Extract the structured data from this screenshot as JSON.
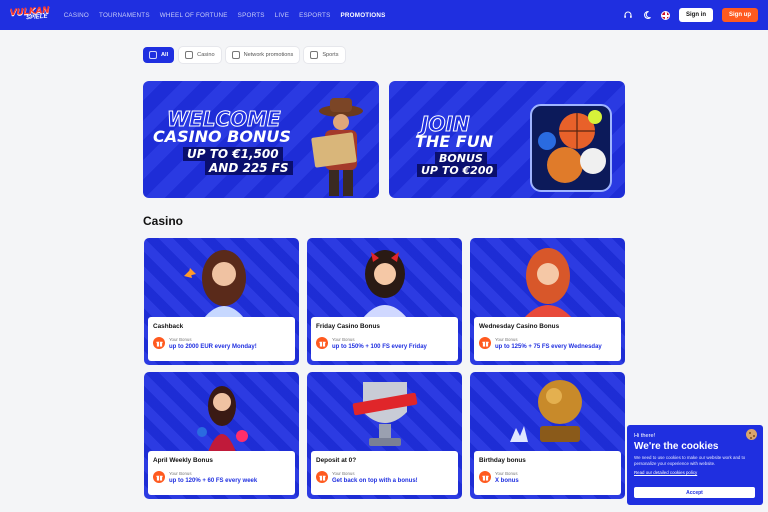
{
  "header": {
    "logo_top": "VULKAN",
    "logo_bottom": "SPIELE",
    "nav": [
      "CASINO",
      "TOURNAMENTS",
      "WHEEL OF FORTUNE",
      "SPORTS",
      "LIVE",
      "ESPORTS",
      "PROMOTIONS"
    ],
    "active_nav": "PROMOTIONS",
    "sign_in": "Sign in",
    "sign_up": "Sign up"
  },
  "filters": [
    "All",
    "Casino",
    "Network promotions",
    "Sports"
  ],
  "banners": {
    "welcome": {
      "line1": "WELCOME",
      "line2": "CASINO BONUS",
      "line3": "UP TO €1,500",
      "line4": "AND 225 FS"
    },
    "join": {
      "line1": "JOIN",
      "line2": "THE FUN",
      "line3": "BONUS",
      "line4": "UP TO €200"
    }
  },
  "section_title": "Casino",
  "cards": [
    {
      "title": "Cashback",
      "label": "Your Bonus",
      "value": "up to 2000 EUR every Monday!"
    },
    {
      "title": "Friday Casino Bonus",
      "label": "Your Bonus",
      "value": "up to 150% + 100 FS every Friday"
    },
    {
      "title": "Wednesday Casino Bonus",
      "label": "Your Bonus",
      "value": "up to 125% + 75 FS every Wednesday"
    },
    {
      "title": "April Weekly Bonus",
      "label": "Your Bonus",
      "value": "up to 120% + 60 FS every week"
    },
    {
      "title": "Deposit at 0?",
      "label": "Your Bonus",
      "value": "Get back on top with a bonus!"
    },
    {
      "title": "Birthday bonus",
      "label": "Your Bonus",
      "value": "X bonus"
    }
  ],
  "cookie": {
    "hi": "Hi there!",
    "title": "We're the cookies",
    "desc": "We need to use cookies to make our website work and to personalize your experience with website.",
    "link": "Read our detailed cookies policy",
    "accept": "Accept"
  },
  "colors": {
    "brand_blue": "#1f2fe0",
    "accent_orange": "#ff5a1f"
  }
}
